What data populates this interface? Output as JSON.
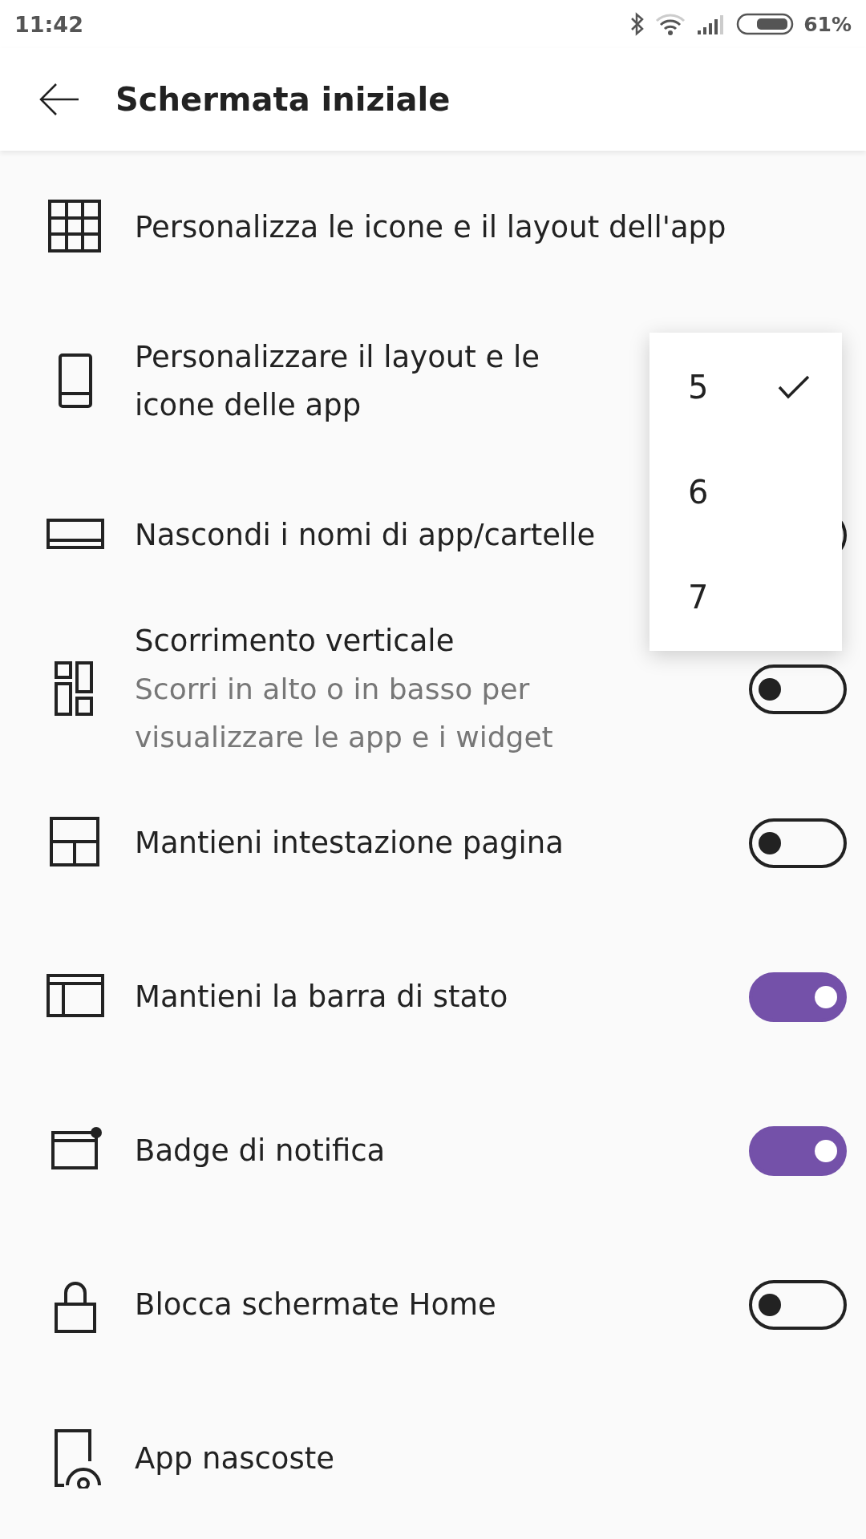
{
  "status_bar": {
    "time": "11:42",
    "battery": "61%"
  },
  "header": {
    "title": "Schermata iniziale"
  },
  "rows": [
    {
      "kind": "link",
      "label": "Personalizza le icone e il layout dell'app"
    },
    {
      "kind": "menu",
      "label": "Personalizzare il layout e le icone delle app"
    },
    {
      "kind": "toggle",
      "label": "Nascondi i nomi di app/cartelle",
      "on": false
    },
    {
      "kind": "toggle",
      "label": "Scorrimento verticale",
      "sublabel": "Scorri in alto o in basso per visualizzare le app e i widget",
      "on": false
    },
    {
      "kind": "toggle",
      "label": "Mantieni intestazione pagina",
      "on": false
    },
    {
      "kind": "toggle",
      "label": "Mantieni la barra di stato",
      "on": true
    },
    {
      "kind": "toggle",
      "label": "Badge di notifica",
      "on": true
    },
    {
      "kind": "toggle",
      "label": "Blocca schermate Home",
      "on": false
    },
    {
      "kind": "link",
      "label": "App nascoste"
    }
  ],
  "menu": {
    "items": [
      {
        "label": "5",
        "selected": true
      },
      {
        "label": "6",
        "selected": false
      },
      {
        "label": "7",
        "selected": false
      }
    ]
  }
}
